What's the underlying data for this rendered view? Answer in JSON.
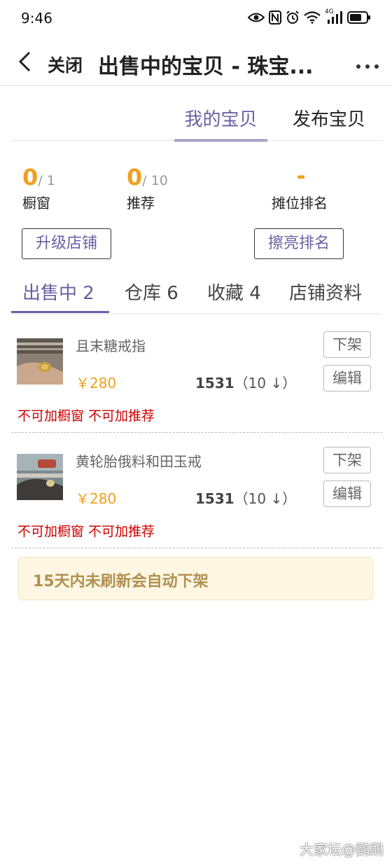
{
  "status_bar": {
    "time": "9:46",
    "network_label": "4G"
  },
  "header": {
    "close_label": "关闭",
    "title": "出售中的宝贝 - 珠宝..."
  },
  "top_tabs": [
    {
      "label": "我的宝贝",
      "active": true
    },
    {
      "label": "发布宝贝",
      "active": false
    }
  ],
  "stats": [
    {
      "value": "0",
      "total": "/ 1",
      "label": "橱窗"
    },
    {
      "value": "0",
      "total": "/ 10",
      "label": "推荐"
    },
    {
      "value": "-",
      "total": "",
      "label": "摊位排名"
    }
  ],
  "actions": {
    "upgrade_label": "升级店铺",
    "polish_label": "擦亮排名"
  },
  "item_tabs": [
    {
      "label": "出售中 2",
      "active": true
    },
    {
      "label": "仓库 6",
      "active": false
    },
    {
      "label": "收藏 4",
      "active": false
    },
    {
      "label": "店铺资料",
      "active": false
    }
  ],
  "products": [
    {
      "name": "且末糖戒指",
      "price": "￥280",
      "views": "1531",
      "rank": "（10 ↓）",
      "warning": "不可加橱窗 不可加推荐",
      "delist_label": "下架",
      "edit_label": "编辑"
    },
    {
      "name": "黄轮胎俄料和田玉戒",
      "price": "￥280",
      "views": "1531",
      "rank": "（10 ↓）",
      "warning": "不可加橱窗 不可加推荐",
      "delist_label": "下架",
      "edit_label": "编辑"
    }
  ],
  "notice": "15天内未刷新会自动下架",
  "watermark": "大家坛@鹦鹉",
  "colors": {
    "accent": "#6a5fa4",
    "price": "#f0a020",
    "warning": "#cc0000",
    "notice_bg": "#fcf6e2",
    "notice_text": "#b09050"
  }
}
